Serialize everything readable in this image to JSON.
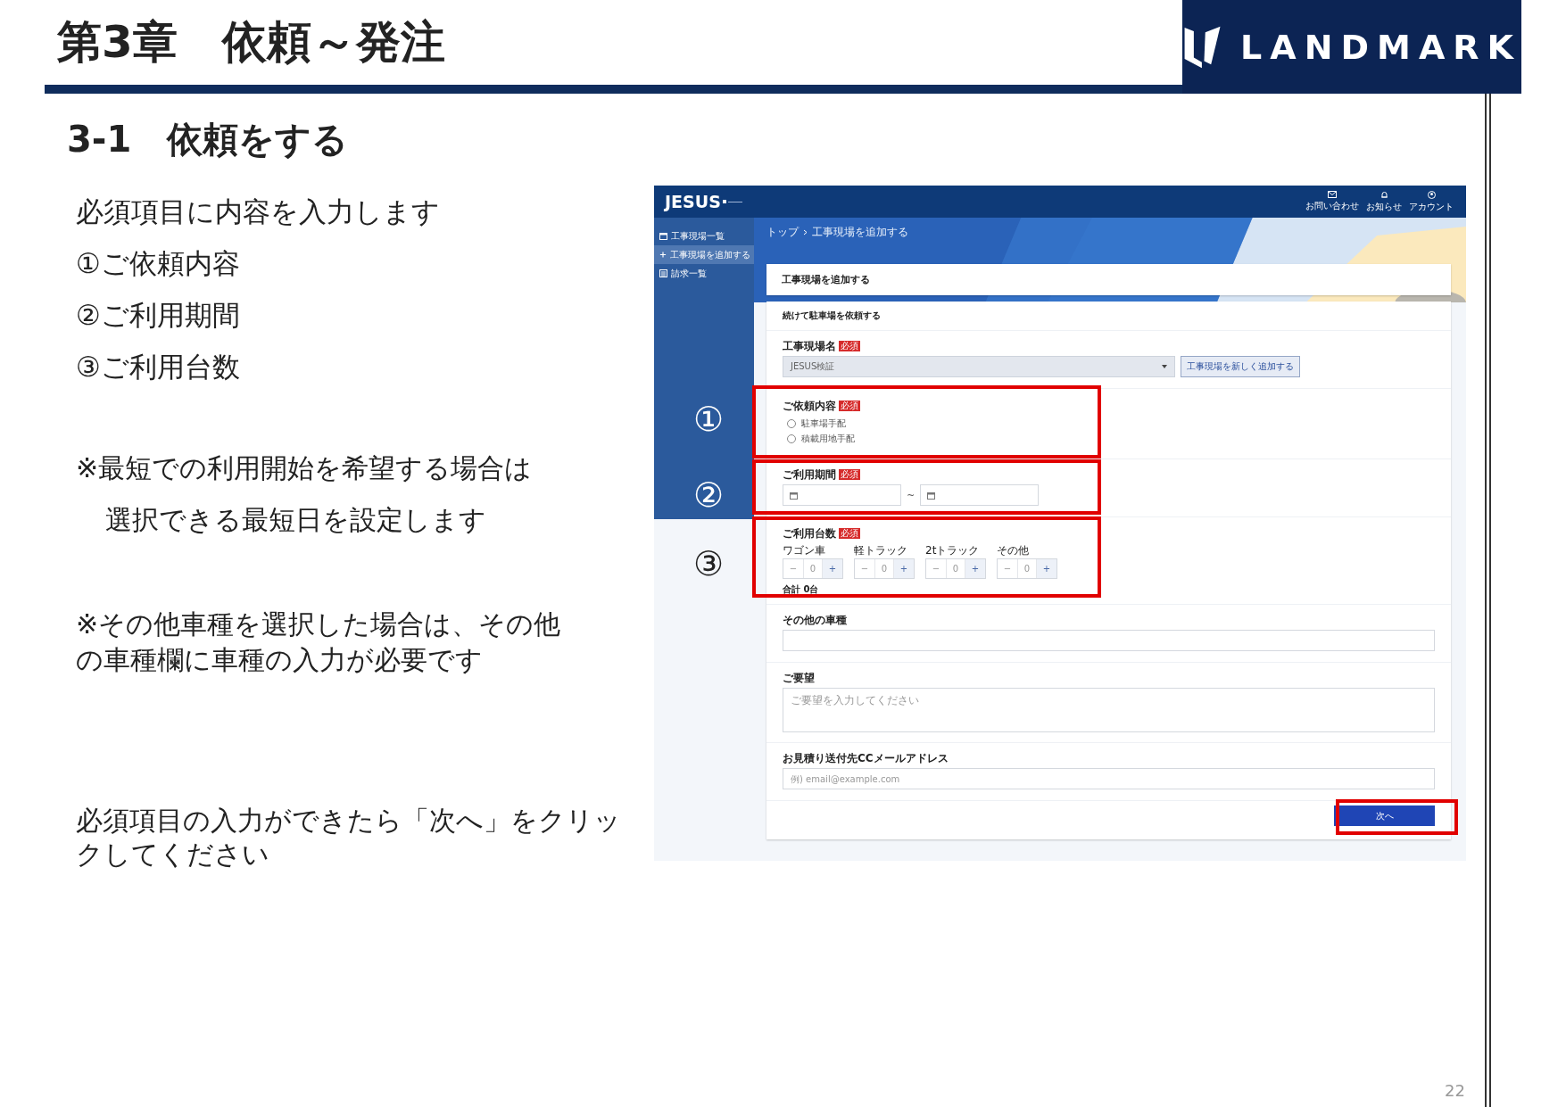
{
  "chapter_title": "第3章　依頼～発注",
  "logo": {
    "text": "LANDMARK"
  },
  "section_title": "3-1　依頼をする",
  "steps": [
    "必須項目に内容を入力します",
    "①ご依頼内容",
    "②ご利用期間",
    "③ご利用台数"
  ],
  "notes": [
    {
      "hanging": true,
      "lines": [
        "※最短での利用開始を希望する場合は",
        "選択できる最短日を設定します"
      ]
    },
    {
      "hanging": false,
      "lines": [
        "※その他車種を選択した場合は、その他",
        "の車種欄に車種の入力が必要です"
      ]
    },
    {
      "hanging": false,
      "lines": [
        "必須項目の入力ができたら「次へ」をクリッ",
        "クしてください"
      ]
    }
  ],
  "screenshot": {
    "app_name": "JESUS",
    "header_links": [
      {
        "label": "お問い合わせ"
      },
      {
        "label": "お知らせ"
      },
      {
        "label": "アカウント"
      }
    ],
    "sidebar": [
      {
        "label": "工事現場一覧",
        "selected": false
      },
      {
        "label": "工事現場を追加する",
        "selected": true
      },
      {
        "label": "請求一覧",
        "selected": false
      }
    ],
    "breadcrumb": [
      "トップ",
      "工事現場を追加する"
    ],
    "page_title": "工事現場を追加する",
    "form": {
      "subtitle": "続けて駐車場を依頼する",
      "site": {
        "label": "工事現場名",
        "required": "必須",
        "value": "JESUS検証",
        "add_button": "工事現場を新しく追加する"
      },
      "request": {
        "label": "ご依頼内容",
        "required": "必須",
        "options": [
          {
            "label": "駐車場手配",
            "selected": false
          },
          {
            "label": "積載用地手配",
            "selected": false
          }
        ]
      },
      "period": {
        "label": "ご利用期間",
        "required": "必須",
        "separator": "~"
      },
      "vehicles": {
        "label": "ご利用台数",
        "required": "必須",
        "total": "合計 0台",
        "counters": [
          {
            "label": "ワゴン車",
            "minus": "−",
            "value": "0",
            "plus": "+"
          },
          {
            "label": "軽トラック",
            "minus": "−",
            "value": "0",
            "plus": "+"
          },
          {
            "label": "2tトラック",
            "minus": "−",
            "value": "0",
            "plus": "+"
          },
          {
            "label": "その他",
            "minus": "−",
            "value": "0",
            "plus": "+"
          }
        ]
      },
      "other_type": {
        "label": "その他の車種"
      },
      "request_note": {
        "label": "ご要望",
        "placeholder": "ご要望を入力してください"
      },
      "cc_email": {
        "label": "お見積り送付先CCメールアドレス",
        "placeholder": "例) email@example.com"
      },
      "next_button": "次へ"
    }
  },
  "callouts": [
    "①",
    "②",
    "③"
  ],
  "page_number": "22"
}
